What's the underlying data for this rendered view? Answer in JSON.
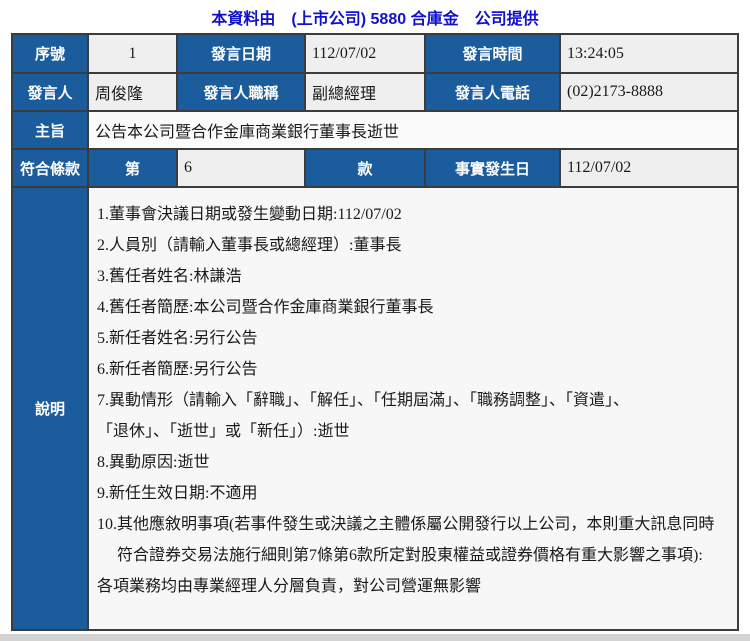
{
  "header": {
    "title": "本資料由　(上市公司) 5880 合庫金　公司提供"
  },
  "colors": {
    "title_text_blue": "#1111CC",
    "header_cell_blue": "#1A5C9C",
    "value_cell_gray": "#EFEFEF",
    "description_cell_bg": "#F7F7F7",
    "page_background": "#D3D3D3",
    "table_border": "#3C3C3C"
  },
  "rows": {
    "serial": {
      "label": "序號",
      "value": "1"
    },
    "announce_date": {
      "label": "發言日期",
      "value": "112/07/02"
    },
    "announce_time": {
      "label": "發言時間",
      "value": "13:24:05"
    },
    "speaker": {
      "label": "發言人",
      "value": "周俊隆"
    },
    "speaker_title": {
      "label": "發言人職稱",
      "value": "副總經理"
    },
    "speaker_phone": {
      "label": "發言人電話",
      "value": "(02)2173-8888"
    },
    "subject": {
      "label": "主旨",
      "value": "公告本公司暨合作金庫商業銀行董事長逝世"
    },
    "clause": {
      "label": "符合條款",
      "article_label": "第",
      "article_value": "6",
      "item_label": "款"
    },
    "fact_date": {
      "label": "事實發生日",
      "value": "112/07/02"
    },
    "description": {
      "label": "說明",
      "lines": [
        "1.董事會決議日期或發生變動日期:112/07/02",
        "2.人員別（請輸入董事長或總經理）:董事長",
        "3.舊任者姓名:林謙浩",
        "4.舊任者簡歷:本公司暨合作金庫商業銀行董事長",
        "5.新任者姓名:另行公告",
        "6.新任者簡歷:另行公告",
        "7.異動情形（請輸入「辭職」、「解任」、「任期屆滿」、「職務調整」、「資遣」、",
        "「退休」、「逝世」或「新任」）:逝世",
        "8.異動原因:逝世",
        "9.新任生效日期:不適用",
        "10.其他應敘明事項(若事件發生或決議之主體係屬公開發行以上公司，本則重大訊息同時",
        "　 符合證券交易法施行細則第7條第6款所定對股東權益或證券價格有重大影響之事項):",
        "各項業務均由專業經理人分層負責，對公司營運無影響"
      ]
    }
  }
}
